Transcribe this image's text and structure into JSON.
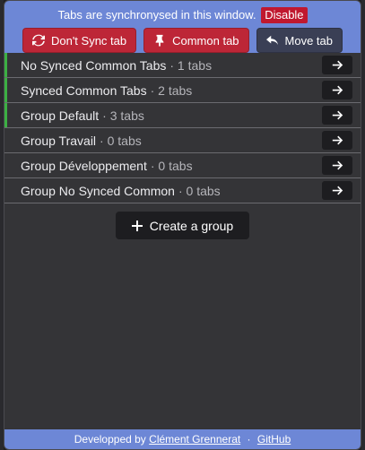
{
  "header": {
    "sync_text": "Tabs are synchronysed in this window.",
    "disable_label": "Disable",
    "buttons": [
      {
        "label": "Don't Sync tab",
        "icon": "sync-icon",
        "color": "#bd2637"
      },
      {
        "label": "Common tab",
        "icon": "pin-icon",
        "color": "#bd2637"
      },
      {
        "label": "Move tab",
        "icon": "reply-arrow-icon",
        "color": "#3a3f55"
      }
    ]
  },
  "groups": [
    {
      "name": "No Synced Common Tabs",
      "count": "· 1 tabs",
      "synced": true
    },
    {
      "name": "Synced Common Tabs",
      "count": "· 2 tabs",
      "synced": true
    },
    {
      "name": "Group Default",
      "count": "· 3 tabs",
      "synced": true
    },
    {
      "name": "Group Travail",
      "count": "· 0 tabs",
      "synced": false
    },
    {
      "name": "Group Développement",
      "count": "· 0 tabs",
      "synced": false
    },
    {
      "name": "Group No Synced Common",
      "count": "· 0 tabs",
      "synced": false
    }
  ],
  "create_group_label": "Create a group",
  "footer": {
    "prefix": "Developped by",
    "author": "Clément Grennerat",
    "separator": "·",
    "github": "GitHub"
  },
  "colors": {
    "header_bg": "#6d87d6",
    "danger": "#bd2637",
    "synced_indicator": "#3cb043",
    "panel_bg": "#343437"
  }
}
